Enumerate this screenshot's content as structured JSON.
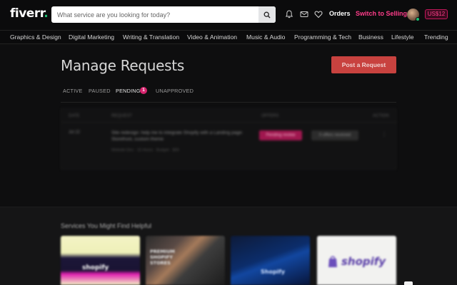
{
  "header": {
    "logo": "fiverr",
    "logo_dot": ".",
    "search_placeholder": "What service are you looking for today?",
    "orders": "Orders",
    "switch_selling": "Switch to Selling",
    "balance": "US$12"
  },
  "categories": [
    "Graphics & Design",
    "Digital Marketing",
    "Writing & Translation",
    "Video & Animation",
    "Music & Audio",
    "Programming & Tech",
    "Business",
    "Lifestyle",
    "Trending"
  ],
  "page": {
    "title": "Manage Requests",
    "post_button": "Post a Request",
    "tabs": [
      {
        "label": "ACTIVE"
      },
      {
        "label": "PAUSED"
      },
      {
        "label": "PENDING",
        "count": "1"
      },
      {
        "label": "UNAPPROVED"
      }
    ]
  },
  "table": {
    "headers": [
      "DATE",
      "REQUEST",
      "OFFERS",
      "ACTION"
    ],
    "row": {
      "date": "Jul 22",
      "description": "Site redesign: help me to integrate Shopify with a Landing page: Storefront, custom theme",
      "meta": "Website Dev · 15 Hours · Budget · $99",
      "status": "Pending review",
      "secondary": "0 offers received"
    }
  },
  "section": {
    "title": "Services You Might Find Helpful",
    "cards": [
      {
        "label": "shopify"
      },
      {
        "label": "PREMIUM SHOPIFY STORES"
      },
      {
        "label": "Shopify"
      },
      {
        "label": "shopify"
      }
    ]
  },
  "colors": {
    "accent": "#1dbf73",
    "pink": "#ff3d8a",
    "post_button": "#c8423f"
  }
}
